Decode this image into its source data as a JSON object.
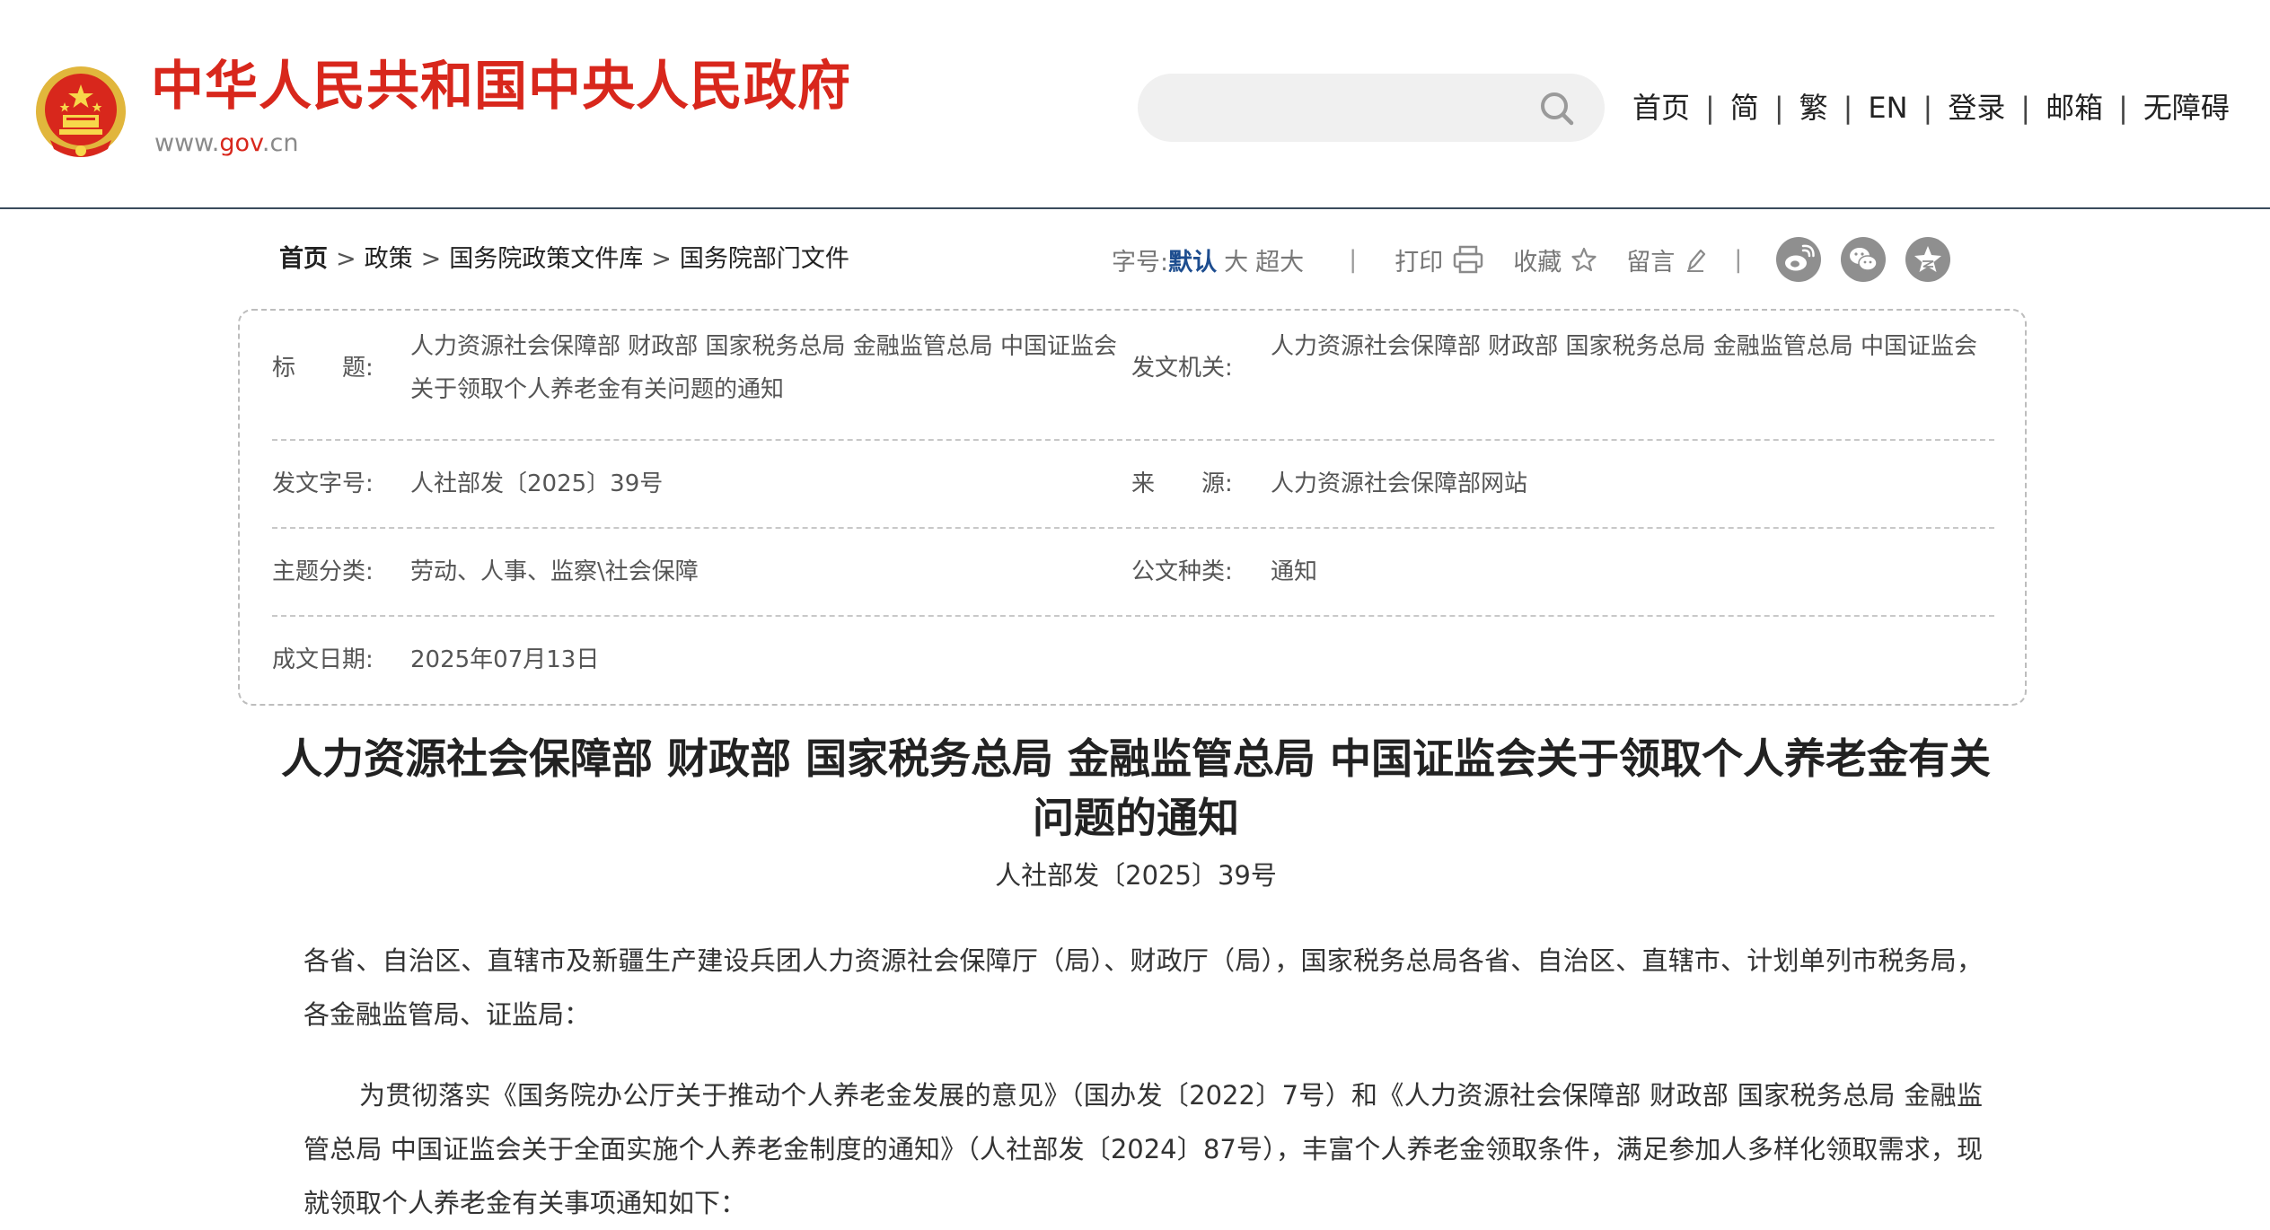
{
  "header": {
    "site_title": "中华人民共和国中央人民政府",
    "site_url_prefix": "www.",
    "site_url_highlight": "gov",
    "site_url_suffix": ".cn",
    "search_placeholder": "",
    "nav": [
      "首页",
      "简",
      "繁",
      "EN",
      "登录",
      "邮箱",
      "无障碍"
    ],
    "nav_separator": "|",
    "brand_color": "#d8271c"
  },
  "breadcrumb": {
    "items": [
      "首页",
      "政策",
      "国务院政策文件库",
      "国务院部门文件"
    ],
    "separator": ">"
  },
  "toolbar": {
    "font_size_label": "字号:",
    "font_sizes": [
      "默认",
      "大",
      "超大"
    ],
    "active_font_size": "默认",
    "separator": "|",
    "print_label": "打印",
    "favorite_label": "收藏",
    "comment_label": "留言",
    "share_icons": [
      "weibo-icon",
      "wechat-icon",
      "qzone-icon"
    ]
  },
  "info": {
    "title_label": "标　　题:",
    "title_value": "人力资源社会保障部 财政部 国家税务总局 金融监管总局 中国证监会关于领取个人养老金有关问题的通知",
    "issuer_label": "发文机关:",
    "issuer_value": "人力资源社会保障部 财政部 国家税务总局 金融监管总局 中国证监会",
    "docno_label": "发文字号:",
    "docno_value": "人社部发〔2025〕39号",
    "source_label": "来　　源:",
    "source_value": "人力资源社会保障部网站",
    "topic_label": "主题分类:",
    "topic_value": "劳动、人事、监察\\社会保障",
    "doctype_label": "公文种类:",
    "doctype_value": "通知",
    "date_label": "成文日期:",
    "date_value": "2025年07月13日"
  },
  "article": {
    "title": "人力资源社会保障部 财政部 国家税务总局 金融监管总局 中国证监会关于领取个人养老金有关问题的通知",
    "doc_number": "人社部发〔2025〕39号",
    "addressee": "各省、自治区、直辖市及新疆生产建设兵团人力资源社会保障厅（局）、财政厅（局），国家税务总局各省、自治区、直辖市、计划单列市税务局，各金融监管局、证监局：",
    "paragraph1": "为贯彻落实《国务院办公厅关于推动个人养老金发展的意见》（国办发〔2022〕7号）和《人力资源社会保障部 财政部 国家税务总局 金融监管总局 中国证监会关于全面实施个人养老金制度的通知》（人社部发〔2024〕87号），丰富个人养老金领取条件，满足参加人多样化领取需求，现就领取个人养老金有关事项通知如下："
  }
}
